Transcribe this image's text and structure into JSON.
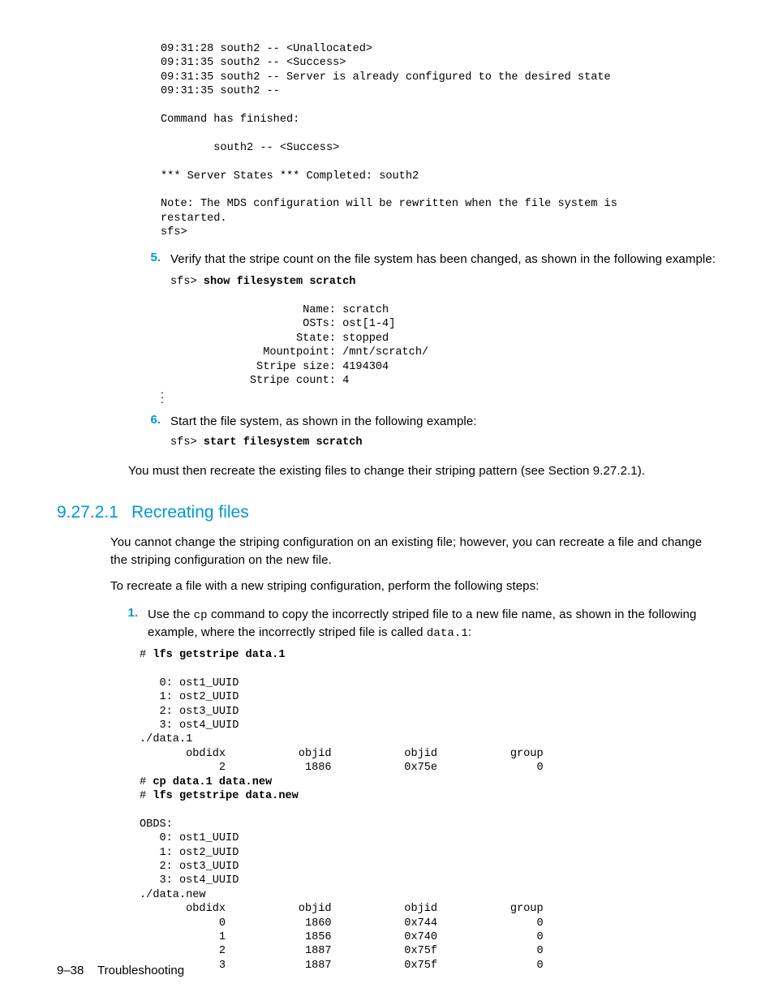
{
  "code1": "09:31:28 south2 -- <Unallocated>\n09:31:35 south2 -- <Success>\n09:31:35 south2 -- Server is already configured to the desired state\n09:31:35 south2 --\n\nCommand has finished:\n\n        south2 -- <Success>\n\n*** Server States *** Completed: south2\n\nNote: The MDS configuration will be rewritten when the file system is\nrestarted.\nsfs>",
  "step5": {
    "num": "5.",
    "text": "Verify that the stripe count on the file system has been changed, as shown in the following example:",
    "prompt": "sfs> ",
    "cmd": "show filesystem scratch",
    "out": "\n                    Name: scratch\n                    OSTs: ost[1-4]\n                   State: stopped\n              Mountpoint: /mnt/scratch/\n             Stripe size: 4194304\n            Stripe count: 4"
  },
  "step6": {
    "num": "6.",
    "text": "Start the file system, as shown in the following example:",
    "prompt": "sfs> ",
    "cmd": "start filesystem scratch"
  },
  "closing": "You must then recreate the existing files to change their striping pattern (see Section 9.27.2.1).",
  "section": {
    "num": "9.27.2.1",
    "title": "Recreating files"
  },
  "para1": "You cannot change the striping configuration on an existing file; however, you can recreate a file and change the striping configuration on the new file.",
  "para2": "To recreate a file with a new striping configuration, perform the following steps:",
  "step1": {
    "num": "1.",
    "pre": "Use the ",
    "cp": "cp",
    "mid": " command to copy the incorrectly striped file to a new file name, as shown in the following example, where the incorrectly striped file is called ",
    "fname": "data.1",
    "post": ":",
    "code_p1": "# ",
    "code_b1": "lfs getstripe data.1",
    "code_r1": "\n\n   0: ost1_UUID\n   1: ost2_UUID\n   2: ost3_UUID\n   3: ost4_UUID\n./data.1\n       obdidx           objid           objid           group\n            2            1886           0x75e               0\n# ",
    "code_b2": "cp data.1 data.new",
    "code_r2": "\n# ",
    "code_b3": "lfs getstripe data.new",
    "code_r3": "\n\nOBDS:\n   0: ost1_UUID\n   1: ost2_UUID\n   2: ost3_UUID\n   3: ost4_UUID\n./data.new\n       obdidx           objid           objid           group\n            0            1860           0x744               0\n            1            1856           0x740               0\n            2            1887           0x75f               0\n            3            1887           0x75f               0"
  },
  "footer": {
    "page": "9–38",
    "label": "Troubleshooting"
  }
}
